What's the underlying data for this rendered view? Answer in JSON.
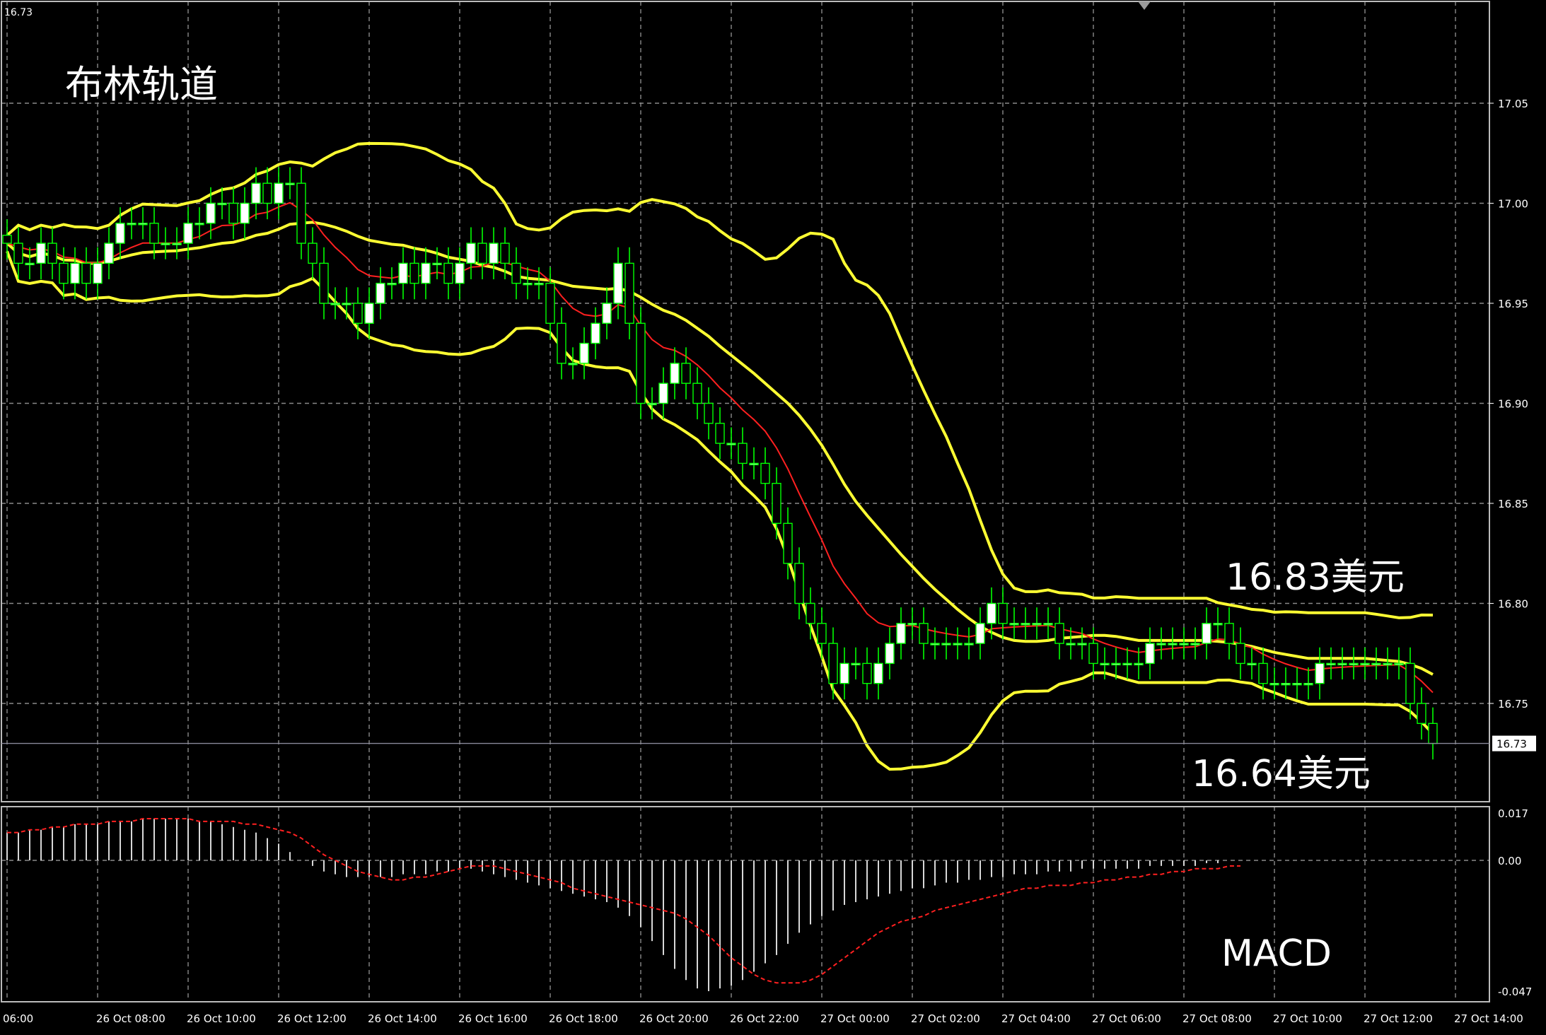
{
  "chart_data": [
    {
      "type": "candlestick",
      "title": "布林轨道",
      "annotations": {
        "upper_price": "16.83美元",
        "lower_price": "16.64美元"
      },
      "corner_label": "16.73",
      "current_price_label": "16.73",
      "current_price": 16.73,
      "ylim": [
        16.7,
        17.1
      ],
      "y_ticks": [
        "17.05",
        "17.00",
        "16.95",
        "16.90",
        "16.85",
        "16.80",
        "16.75"
      ],
      "x_ticks": [
        "06:00",
        "26 Oct 08:00",
        "26 Oct 10:00",
        "26 Oct 12:00",
        "26 Oct 14:00",
        "26 Oct 16:00",
        "26 Oct 18:00",
        "26 Oct 20:00",
        "26 Oct 22:00",
        "27 Oct 00:00",
        "27 Oct 02:00",
        "27 Oct 04:00",
        "27 Oct 06:00",
        "27 Oct 08:00",
        "27 Oct 10:00",
        "27 Oct 12:00",
        "27 Oct 14:00"
      ],
      "bars_per_x_tick": 8,
      "grid": true,
      "colors": {
        "background": "#000000",
        "candle_bull": "#ffffff",
        "candle_bear": "#000000",
        "candle_outline": "#00ff00",
        "wick": "#00ff00",
        "bollinger": "#ffff33",
        "middle_ma": "#ff2020",
        "grid": "#8a8a8a"
      },
      "close": [
        16.98,
        16.97,
        16.97,
        16.98,
        16.97,
        16.96,
        16.97,
        16.96,
        16.97,
        16.98,
        16.99,
        16.99,
        16.99,
        16.98,
        16.98,
        16.98,
        16.99,
        16.99,
        17.0,
        17.0,
        16.99,
        17.0,
        17.01,
        17.0,
        17.01,
        17.01,
        16.98,
        16.97,
        16.95,
        16.95,
        16.95,
        16.94,
        16.95,
        16.96,
        16.96,
        16.97,
        16.96,
        16.97,
        16.97,
        16.96,
        16.97,
        16.98,
        16.97,
        16.98,
        16.97,
        16.96,
        16.96,
        16.96,
        16.94,
        16.92,
        16.92,
        16.93,
        16.94,
        16.95,
        16.97,
        16.94,
        16.9,
        16.9,
        16.91,
        16.92,
        16.91,
        16.9,
        16.89,
        16.88,
        16.88,
        16.87,
        16.87,
        16.86,
        16.84,
        16.82,
        16.8,
        16.79,
        16.78,
        16.76,
        16.77,
        16.77,
        16.76,
        16.77,
        16.78,
        16.79,
        16.79,
        16.78,
        16.78,
        16.78,
        16.78,
        16.78,
        16.79,
        16.8,
        16.79,
        16.79,
        16.79,
        16.79,
        16.79,
        16.78,
        16.78,
        16.78,
        16.77,
        16.77,
        16.77,
        16.77,
        16.77,
        16.78,
        16.78,
        16.78,
        16.78,
        16.78,
        16.79,
        16.79,
        16.78,
        16.77,
        16.77,
        16.76,
        16.76,
        16.76,
        16.76,
        16.76,
        16.77,
        16.77,
        16.77,
        16.77,
        16.77,
        16.77,
        16.77,
        16.77,
        16.75,
        16.74,
        16.73
      ],
      "macd_signal": [
        0.01,
        0.01,
        0.011,
        0.011,
        0.012,
        0.012,
        0.013,
        0.013,
        0.013,
        0.014,
        0.014,
        0.014,
        0.015,
        0.015,
        0.015,
        0.015,
        0.015,
        0.014,
        0.014,
        0.014,
        0.014,
        0.013,
        0.013,
        0.012,
        0.011,
        0.01,
        0.008,
        0.005,
        0.002,
        0.0,
        -0.002,
        -0.004,
        -0.005,
        -0.006,
        -0.007,
        -0.007,
        -0.006,
        -0.006,
        -0.005,
        -0.004,
        -0.003,
        -0.002,
        -0.002,
        -0.002,
        -0.003,
        -0.004,
        -0.005,
        -0.006,
        -0.007,
        -0.008,
        -0.01,
        -0.011,
        -0.012,
        -0.013,
        -0.014,
        -0.015,
        -0.016,
        -0.017,
        -0.018,
        -0.019,
        -0.021,
        -0.024,
        -0.027,
        -0.031,
        -0.035,
        -0.038,
        -0.041,
        -0.043,
        -0.044,
        -0.044,
        -0.044,
        -0.043,
        -0.041,
        -0.038,
        -0.035,
        -0.032,
        -0.029,
        -0.026,
        -0.024,
        -0.022,
        -0.021,
        -0.02,
        -0.018,
        -0.017,
        -0.016,
        -0.015,
        -0.014,
        -0.013,
        -0.012,
        -0.011,
        -0.01,
        -0.01,
        -0.009,
        -0.009,
        -0.009,
        -0.008,
        -0.008,
        -0.007,
        -0.007,
        -0.006,
        -0.006,
        -0.005,
        -0.005,
        -0.004,
        -0.004,
        -0.003,
        -0.003,
        -0.003,
        -0.002,
        -0.002
      ],
      "macd_hist": [
        0.01,
        0.01,
        0.011,
        0.011,
        0.012,
        0.012,
        0.013,
        0.013,
        0.013,
        0.014,
        0.014,
        0.014,
        0.015,
        0.015,
        0.015,
        0.015,
        0.015,
        0.014,
        0.014,
        0.013,
        0.012,
        0.011,
        0.01,
        0.008,
        0.006,
        0.003,
        0.0,
        -0.002,
        -0.004,
        -0.005,
        -0.006,
        -0.006,
        -0.006,
        -0.006,
        -0.006,
        -0.005,
        -0.005,
        -0.005,
        -0.004,
        -0.004,
        -0.003,
        -0.003,
        -0.004,
        -0.005,
        -0.006,
        -0.007,
        -0.008,
        -0.009,
        -0.01,
        -0.011,
        -0.012,
        -0.013,
        -0.014,
        -0.015,
        -0.017,
        -0.02,
        -0.024,
        -0.029,
        -0.034,
        -0.039,
        -0.043,
        -0.046,
        -0.047,
        -0.046,
        -0.045,
        -0.043,
        -0.04,
        -0.037,
        -0.034,
        -0.03,
        -0.026,
        -0.023,
        -0.02,
        -0.018,
        -0.016,
        -0.015,
        -0.014,
        -0.013,
        -0.012,
        -0.011,
        -0.01,
        -0.01,
        -0.009,
        -0.008,
        -0.008,
        -0.007,
        -0.007,
        -0.006,
        -0.006,
        -0.005,
        -0.005,
        -0.005,
        -0.004,
        -0.004,
        -0.004,
        -0.003,
        -0.003,
        -0.003,
        -0.003,
        -0.003,
        -0.003,
        -0.002,
        -0.002,
        -0.002,
        -0.002,
        -0.002,
        -0.001,
        -0.001
      ],
      "macd_ylim": [
        -0.047,
        0.017
      ],
      "macd_ticks": [
        "0.017",
        "0.00",
        "-0.047"
      ],
      "macd_label": "MACD"
    }
  ]
}
